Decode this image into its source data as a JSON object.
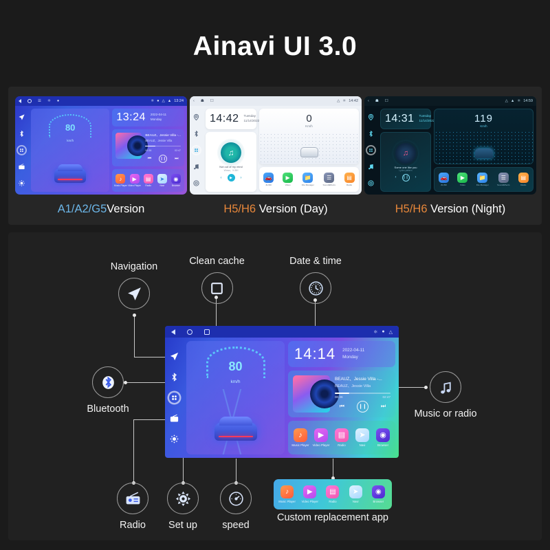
{
  "title": "Ainavi  UI 3.0",
  "devices": [
    {
      "caption_accent": "A1/A2/G5",
      "caption_rest": "Version",
      "accent_color": "#6cb6e8",
      "time": "13:24",
      "date": "2022-04-11",
      "weekday": "Monday",
      "statusbar_time": "13:24",
      "speed": "80",
      "speed_unit": "km/h",
      "song_title": "BEAUZ、Jessie Villa -...",
      "song_artist": "BEAUZ、Jessie Villa",
      "elapsed": "00:36",
      "duration": "02:47",
      "apps": [
        "Music Player",
        "Video Player",
        "Radio",
        "Navi",
        "Browser"
      ]
    },
    {
      "caption_accent": "H5/H6",
      "caption_rest": "Version (Day)",
      "accent_color": "#e8873a",
      "time": "14:42",
      "weekday": "Tuesday",
      "date": "11/14/2022",
      "statusbar_time": "14:42",
      "speed": "0",
      "speed_unit": "Km/h",
      "song_title": "Not out of my mind",
      "song_artist": "Wowo、N.BH",
      "apps": [
        "ZLINK",
        "Video",
        "File Manager",
        "SoundEffects",
        "Radio"
      ]
    },
    {
      "caption_accent": "H5/H6",
      "caption_rest": "Version (Night)",
      "accent_color": "#e8873a",
      "time": "14:31",
      "weekday": "Tuesday",
      "date": "11/14/2022",
      "statusbar_time": "14:59",
      "speed": "119",
      "speed_unit": "Km/h",
      "song_title": "Some one like you",
      "song_artist": "Lyrics pattern",
      "apps": [
        "ZLINK",
        "Video",
        "File Manager",
        "SoundEffects",
        "Radio"
      ]
    }
  ],
  "callouts": {
    "navigation": "Navigation",
    "clean_cache": "Clean cache",
    "date_time": "Date & time",
    "bluetooth": "Bluetooth",
    "music_or_radio": "Music or radio",
    "radio": "Radio",
    "set_up": "Set up",
    "speed": "speed",
    "custom_app": "Custom replacement app"
  },
  "main_device": {
    "time": "14:14",
    "date": "2022-04-11",
    "weekday": "Monday",
    "speed": "80",
    "speed_unit": "km/h",
    "song_title": "BEAUZ、Jessie Villa -...",
    "song_artist": "BEAUZ、Jessie Villa",
    "elapsed": "00:36",
    "duration": "02:47",
    "apps": [
      "Music Player",
      "Video Player",
      "Radio",
      "Navi",
      "Browser"
    ]
  },
  "custom_strip_apps": [
    "Music Player",
    "Video Player",
    "Radio",
    "Navi",
    "Browser"
  ]
}
